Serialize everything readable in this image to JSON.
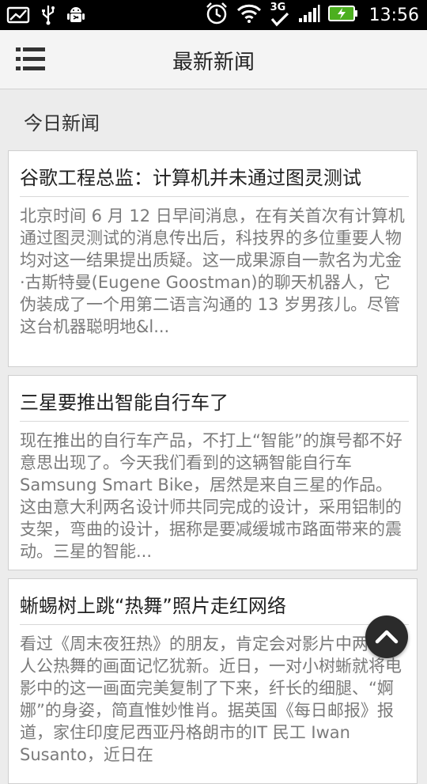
{
  "status_bar": {
    "time": "13:56",
    "network_label": "3G",
    "icons": [
      "gallery-icon",
      "usb-icon",
      "android-debug-icon",
      "alarm-icon",
      "wifi-icon",
      "network-3g-icon",
      "signal-icon",
      "battery-charging-icon"
    ]
  },
  "action_bar": {
    "title": "最新新闻",
    "menu_icon": "hamburger-menu-icon"
  },
  "section": {
    "title": "今日新闻"
  },
  "news": [
    {
      "title": "谷歌工程总监：计算机并未通过图灵测试",
      "summary": "北京时间 6 月 12 日早间消息，在有关首次有计算机通过图灵测试的消息传出后，科技界的多位重要人物均对这一结果提出质疑。这一成果源自一款名为尤金·古斯特曼(Eugene Goostman)的聊天机器人，它伪装成了一个用第二语言沟通的 13 岁男孩儿。尽管这台机器聪明地&l..."
    },
    {
      "title": "三星要推出智能自行车了",
      "summary": "现在推出的自行车产品，不打上“智能”的旗号都不好意思出现了。今天我们看到的这辆智能自行车 Samsung Smart Bike，居然是来自三星的作品。这由意大利两名设计师共同完成的设计，采用铝制的支架，弯曲的设计，据称是要减缓城市路面带来的震动。三星的智能..."
    },
    {
      "title": "蜥蜴树上跳“热舞”照片走红网络",
      "summary": "看过《周末夜狂热》的朋友，肯定会对影片中两位主人公热舞的画面记忆犹新。近日，一对小树蜥就将电影中的这一画面完美复制了下来，纤长的细腿、“婀娜”的身姿，简直惟妙惟肖。据英国《每日邮报》报道，家住印度尼西亚丹格朗市的IT 民工 Iwan Susanto，近日在"
    }
  ],
  "fab": {
    "icon": "chevron-up-icon"
  },
  "colors": {
    "status_bar_bg": "#000000",
    "action_bar_bg": "#f4f4f4",
    "page_bg": "#ececec",
    "card_bg": "#ffffff",
    "summary_text": "#7a7a7a",
    "battery_green": "#4caf1f",
    "fab_bg": "#2b2b2b"
  }
}
